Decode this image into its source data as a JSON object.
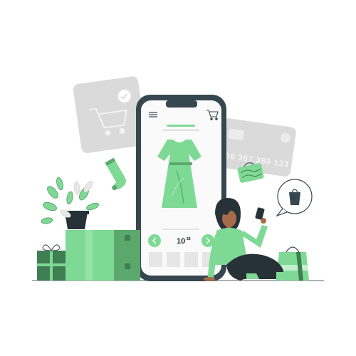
{
  "illustration": {
    "credit_card": {
      "number": "56 367 389 123"
    },
    "product": {
      "price": "10",
      "price_suffix": "$$"
    }
  },
  "colors": {
    "accent_green": "#7ed995",
    "dark_green": "#5aa86c",
    "deep_green": "#3f7d52",
    "dark_slate": "#37474f",
    "light_gray": "#dadada",
    "mid_gray": "#e6e6e6",
    "skin": "#a86b4a",
    "hair": "#263238"
  },
  "icons": {
    "cart": "shopping-cart-icon",
    "menu": "hamburger-menu-icon",
    "bag": "shopping-bag-icon",
    "check": "check-circle-icon"
  }
}
